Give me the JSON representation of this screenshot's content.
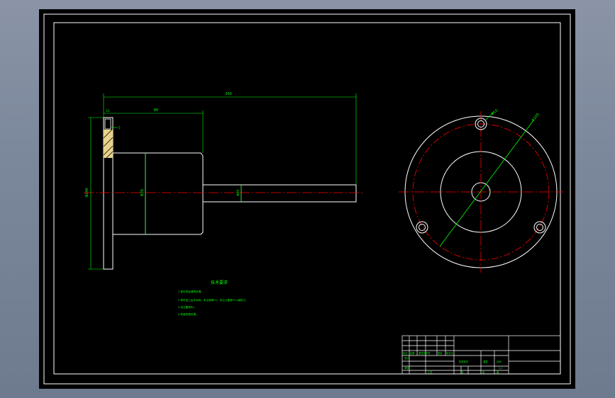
{
  "drawing": {
    "dimensions": {
      "overall_length": "200",
      "flange_thickness": "13",
      "body_length": "80",
      "chamfer": "5",
      "flange_diameter": "Φ240",
      "body_diameter": "Φ76",
      "shaft_diameter": "Φ20",
      "hole_size": "Φ10",
      "pcd": "Φ200"
    },
    "notes": {
      "title": "技术要求",
      "lines": [
        "1.零件须经调质处理。",
        "2.零件加工后去毛刺，未注倒角C1，未注公差按IT12级执行。",
        "3.未注圆角R2。",
        "4.表面发黑处理。"
      ]
    },
    "title_block": {
      "labels": [
        "标记",
        "处数",
        "分区",
        "更改文件号",
        "签名",
        "年月日",
        "设计",
        "标准化",
        "审核",
        "工艺",
        "批准",
        "阶段标记",
        "重量",
        "比例",
        "共",
        "张",
        "第"
      ],
      "scale": "1:1"
    }
  },
  "colors": {
    "background": "#000000",
    "outline": "#ffffff",
    "centerline": "#ff0000",
    "dimension": "#00ff00",
    "hatch": "#f0e0a0",
    "title_block": "#ffffff"
  }
}
